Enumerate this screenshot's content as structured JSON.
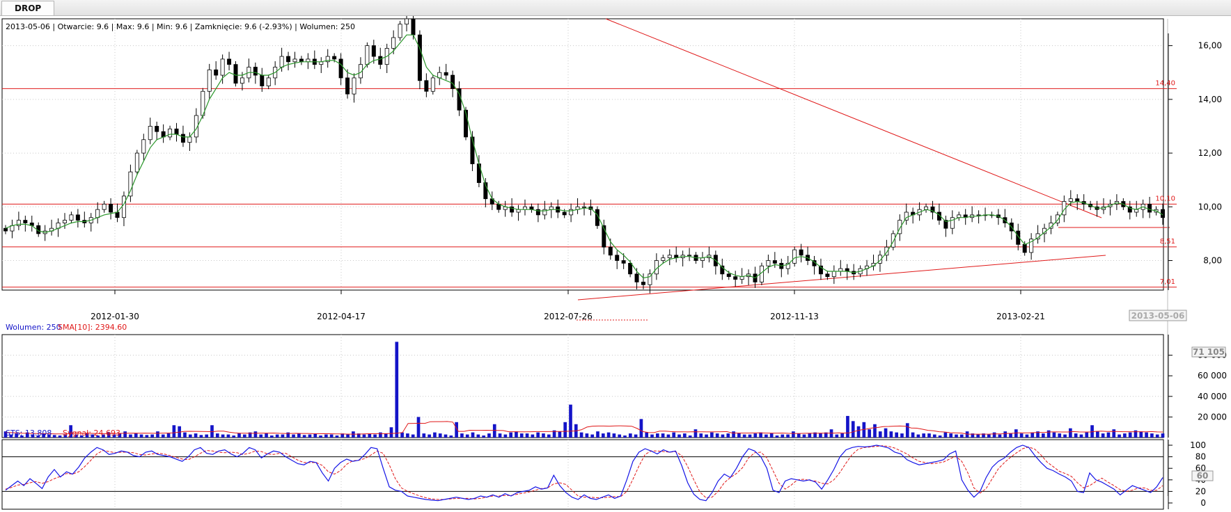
{
  "window": {
    "tab_label": "DROP"
  },
  "chart_data": [
    {
      "type": "candlestick",
      "title": "",
      "info": "2013-05-06 | Otwarcie: 9.6 | Max: 9.6 | Min: 9.6 | Zamknięcie: 9.6 (-2.93%)  | Wolumen: 250",
      "x_axis": {
        "ticks": [
          "2012-01-30",
          "2012-04-17",
          "2012-07-26",
          "2012-11-13",
          "2013-02-21"
        ],
        "current_label": "2013-05-06"
      },
      "y_axis": {
        "range": [
          6.9,
          17.0
        ],
        "ticks": [
          8,
          10,
          12,
          14,
          16
        ],
        "tick_labels": [
          "8,00",
          "10,00",
          "12,00",
          "14,00",
          "16,00"
        ],
        "side": "right"
      },
      "grid": true,
      "horizontal_lines": [
        {
          "value": 14.4,
          "label": "14,40"
        },
        {
          "value": 10.1,
          "label": "10,10"
        },
        {
          "value": 8.51,
          "label": "8,51"
        },
        {
          "value": 7.01,
          "label": "7,01"
        }
      ],
      "overlay_color": "#2a962a",
      "line_color": "#e01818",
      "candle_up_color": "#ffffff",
      "candle_down_color": "#000000",
      "closes": [
        9.1,
        9.3,
        9.5,
        9.4,
        9.3,
        9.0,
        9.1,
        9.2,
        9.4,
        9.5,
        9.7,
        9.5,
        9.4,
        9.6,
        9.9,
        10.1,
        9.8,
        9.6,
        10.4,
        11.3,
        12.0,
        12.5,
        13.0,
        12.8,
        12.6,
        12.9,
        12.7,
        12.4,
        12.6,
        13.4,
        14.3,
        15.1,
        14.9,
        15.5,
        15.3,
        14.6,
        14.8,
        15.2,
        14.9,
        14.5,
        14.8,
        15.2,
        15.6,
        15.4,
        15.5,
        15.4,
        15.5,
        15.3,
        15.4,
        15.6,
        15.5,
        14.8,
        14.2,
        14.8,
        15.3,
        16.0,
        15.6,
        15.3,
        15.9,
        16.3,
        16.8,
        17.0,
        16.4,
        14.7,
        14.3,
        14.8,
        15.0,
        14.9,
        14.4,
        13.6,
        12.6,
        11.6,
        10.9,
        10.3,
        10.1,
        9.9,
        10.0,
        9.8,
        9.9,
        10.0,
        9.9,
        9.7,
        9.9,
        10.0,
        9.8,
        9.7,
        9.9,
        10.0,
        10.0,
        9.9,
        9.3,
        8.5,
        8.2,
        8.0,
        7.9,
        7.5,
        7.2,
        7.1,
        7.5,
        8.0,
        8.1,
        8.2,
        8.1,
        8.2,
        8.2,
        8.0,
        8.1,
        8.2,
        7.8,
        7.5,
        7.4,
        7.3,
        7.4,
        7.5,
        7.2,
        7.8,
        8.0,
        7.9,
        7.7,
        7.9,
        8.4,
        8.2,
        8.0,
        7.8,
        7.5,
        7.4,
        7.6,
        7.7,
        7.6,
        7.5,
        7.7,
        7.8,
        7.9,
        8.2,
        8.5,
        9.0,
        9.5,
        9.8,
        9.7,
        9.9,
        10.0,
        9.8,
        9.5,
        9.2,
        9.6,
        9.7,
        9.6,
        9.7,
        9.7,
        9.7,
        9.7,
        9.6,
        9.4,
        9.1,
        8.6,
        8.3,
        8.8,
        9.0,
        9.2,
        9.4,
        9.7,
        10.2,
        10.3,
        10.2,
        10.1,
        10.0,
        9.9,
        10.0,
        10.1,
        10.2,
        10.0,
        9.8,
        9.9,
        10.1,
        9.8,
        9.9,
        9.6
      ],
      "sma_overlay": [
        9.2,
        9.3,
        9.35,
        9.35,
        9.3,
        9.1,
        9.05,
        9.1,
        9.2,
        9.3,
        9.4,
        9.45,
        9.45,
        9.5,
        9.6,
        9.7,
        9.75,
        9.8,
        10.1,
        10.6,
        11.2,
        11.7,
        12.2,
        12.5,
        12.6,
        12.7,
        12.7,
        12.6,
        12.6,
        12.9,
        13.4,
        14.0,
        14.4,
        14.8,
        15.0,
        14.9,
        14.9,
        15.0,
        15.0,
        14.9,
        14.9,
        15.0,
        15.2,
        15.3,
        15.35,
        15.4,
        15.4,
        15.4,
        15.4,
        15.45,
        15.45,
        15.3,
        15.0,
        14.9,
        15.0,
        15.3,
        15.45,
        15.5,
        15.6,
        15.8,
        16.1,
        16.4,
        16.4,
        15.9,
        15.2,
        14.9,
        14.8,
        14.7,
        14.6,
        14.2,
        13.5,
        12.5,
        11.6,
        10.8,
        10.3,
        10.1,
        10.0,
        9.95,
        9.9,
        9.9,
        9.9,
        9.85,
        9.85,
        9.9,
        9.9,
        9.85,
        9.85,
        9.9,
        9.95,
        9.95,
        9.7,
        9.2,
        8.7,
        8.4,
        8.2,
        7.95,
        7.6,
        7.35,
        7.4,
        7.7,
        7.9,
        8.05,
        8.1,
        8.15,
        8.15,
        8.1,
        8.1,
        8.15,
        8.0,
        7.75,
        7.55,
        7.45,
        7.4,
        7.45,
        7.35,
        7.55,
        7.75,
        7.85,
        7.8,
        7.85,
        8.1,
        8.15,
        8.1,
        7.95,
        7.75,
        7.6,
        7.6,
        7.6,
        7.6,
        7.55,
        7.6,
        7.7,
        7.8,
        8.0,
        8.3,
        8.7,
        9.2,
        9.6,
        9.7,
        9.8,
        9.9,
        9.85,
        9.7,
        9.45,
        9.5,
        9.6,
        9.6,
        9.65,
        9.65,
        9.7,
        9.7,
        9.65,
        9.5,
        9.25,
        8.9,
        8.6,
        8.7,
        8.85,
        9.05,
        9.25,
        9.5,
        9.9,
        10.15,
        10.2,
        10.15,
        10.05,
        9.95,
        9.95,
        10.05,
        10.15,
        10.1,
        9.95,
        9.9,
        10.0,
        9.9,
        9.85,
        9.7
      ],
      "annotations": [
        {
          "value": 17.2,
          "index": 48
        },
        {
          "value": 7.0,
          "index": 100
        }
      ]
    },
    {
      "type": "bar",
      "info_parts": [
        "Wolumen: 250",
        "SMA[10]: 2394.60"
      ],
      "y_axis": {
        "range": [
          0,
          100000
        ],
        "ticks": [
          20000,
          40000,
          60000,
          80000
        ],
        "tick_labels": [
          "20 000",
          "40 000",
          "60 000",
          "80 000"
        ],
        "current_value_label": "71 105"
      },
      "bar_color": "#1414c8",
      "sma_color": "#e01818",
      "values": [
        6000,
        3000,
        4000,
        2000,
        5000,
        3000,
        2000,
        4000,
        3000,
        2500,
        2000,
        3000,
        12000,
        3000,
        2000,
        4000,
        3000,
        2000,
        3000,
        5000,
        3000,
        4000,
        6000,
        3000,
        4000,
        3000,
        2500,
        3000,
        6000,
        3000,
        4000,
        12000,
        11000,
        5000,
        3000,
        4000,
        2500,
        3000,
        12000,
        4000,
        3000,
        3000,
        2000,
        4000,
        3000,
        5000,
        6000,
        3000,
        4000,
        2000,
        3000,
        3000,
        5000,
        3000,
        4000,
        2500,
        3000,
        4000,
        2000,
        3000,
        3000,
        2000,
        4000,
        3000,
        6000,
        4000,
        3000,
        4000,
        3000,
        5000,
        4000,
        10000,
        93000,
        5000,
        4000,
        3000,
        20000,
        4000,
        3000,
        5000,
        4000,
        3000,
        2000,
        15000,
        4000,
        3000,
        5000,
        3000,
        2000,
        4000,
        13000,
        4000,
        3000,
        5000,
        6000,
        4000,
        4000,
        3000,
        5000,
        4000,
        3000,
        7000,
        6000,
        15000,
        32000,
        13000,
        5000,
        4000,
        3000,
        6000,
        4000,
        5000,
        4000,
        3000,
        2000,
        4000,
        3000,
        18000,
        5000,
        3000,
        4000,
        4000,
        3000,
        5000,
        3000,
        4000,
        2000,
        8000,
        4000,
        3000,
        5000,
        4000,
        3000,
        4000,
        6000,
        4000,
        3000,
        3000,
        4000,
        5000,
        3000,
        4000,
        2000,
        3000,
        3000,
        6000,
        4000,
        3000,
        4000,
        5000,
        4000,
        5000,
        8000,
        3000,
        4000,
        21000,
        16000,
        11000,
        15000,
        8000,
        13000,
        6000,
        9000,
        6000,
        5000,
        4000,
        14000,
        5000,
        3000,
        4000,
        4000,
        3000,
        2000,
        5000,
        4000,
        3000,
        3000,
        6000,
        4000,
        3000,
        4000,
        3000,
        5000,
        3000,
        6000,
        4000,
        8000,
        4000,
        3000,
        5000,
        6000,
        4000,
        7000,
        5000,
        4000,
        3000,
        9000,
        4000,
        3000,
        5000,
        12000,
        6000,
        4000,
        5000,
        8000,
        3000,
        4000,
        5000,
        7000,
        6000,
        5000,
        4000,
        3000,
        4000
      ],
      "sma": [
        5000,
        4800,
        4600,
        4200,
        4100,
        4000,
        3900,
        3800,
        3700,
        3600,
        3500,
        3600,
        4400,
        4300,
        4200,
        4100,
        4000,
        3900,
        3800,
        3900,
        4000,
        4100,
        4200,
        4300,
        4200,
        4300,
        4200,
        4100,
        4300,
        4400,
        4500,
        5200,
        6000,
        6100,
        6000,
        5900,
        5800,
        5700,
        6200,
        6200,
        5300,
        4500,
        4200,
        4200,
        4100,
        4200,
        4300,
        4300,
        4400,
        4100,
        4000,
        4000,
        4100,
        4000,
        4000,
        3800,
        3700,
        3800,
        3700,
        3600,
        3500,
        3400,
        3300,
        3300,
        3600,
        3700,
        3700,
        3800,
        3800,
        4000,
        4200,
        4900,
        13700,
        13800,
        13900,
        13800,
        15400,
        15500,
        15500,
        15600,
        15000,
        6000,
        6000,
        7100,
        7000,
        7000,
        7100,
        7000,
        6900,
        6800,
        5700,
        5700,
        5600,
        5600,
        5700,
        5800,
        5800,
        5800,
        5900,
        5900,
        6000,
        6200,
        6400,
        7600,
        10200,
        11100,
        11200,
        11200,
        11100,
        11300,
        11400,
        11200,
        11000,
        8800,
        5800,
        4900,
        4800,
        6200,
        6200,
        5800,
        5600,
        5600,
        5500,
        5700,
        5600,
        5600,
        5500,
        5600,
        5700,
        5800,
        4400,
        4400,
        4400,
        4400,
        4500,
        4500,
        4400,
        4300,
        4300,
        4400,
        4100,
        4000,
        4000,
        4100,
        4200,
        4200,
        4300,
        4300,
        4300,
        4500,
        4400,
        4500,
        6200,
        7400,
        8300,
        9300,
        9800,
        10700,
        10800,
        11100,
        11200,
        11000,
        9300,
        9100,
        8100,
        7000,
        6600,
        5700,
        5400,
        4700,
        4600,
        4400,
        3300,
        3300,
        3300,
        3300,
        3400,
        3600,
        3600,
        4000,
        4100,
        4600,
        4600,
        4600,
        4800,
        5000,
        5100,
        5500,
        5500,
        5400,
        5400,
        5800,
        5500,
        5400,
        5400,
        6000,
        6200,
        5900,
        6000,
        5800,
        5700,
        5700,
        5700,
        5700,
        5600,
        5800,
        5500,
        5400
      ]
    },
    {
      "type": "line",
      "info_parts": [
        "STS: 13.808",
        "Sygnał: 24.693"
      ],
      "y_axis": {
        "range": [
          0,
          100
        ],
        "ticks": [
          0,
          20,
          40,
          60,
          80,
          100
        ],
        "tick_labels": [
          "0",
          "20",
          "40",
          "60",
          "80",
          "100"
        ],
        "current_value_label": "60",
        "levels": [
          20,
          80
        ]
      },
      "series": [
        {
          "name": "STS",
          "color": "#1414e6",
          "values": [
            22,
            30,
            38,
            30,
            42,
            34,
            25,
            45,
            58,
            45,
            54,
            50,
            62,
            78,
            88,
            96,
            92,
            84,
            86,
            90,
            88,
            82,
            80,
            88,
            90,
            84,
            82,
            80,
            76,
            72,
            80,
            92,
            96,
            86,
            84,
            90,
            92,
            85,
            80,
            86,
            96,
            92,
            78,
            85,
            90,
            88,
            80,
            74,
            68,
            66,
            72,
            70,
            52,
            38,
            60,
            70,
            76,
            72,
            74,
            84,
            96,
            94,
            60,
            28,
            22,
            20,
            12,
            10,
            8,
            6,
            5,
            4,
            6,
            8,
            10,
            8,
            6,
            8,
            12,
            10,
            14,
            10,
            16,
            12,
            18,
            20,
            22,
            28,
            24,
            26,
            48,
            30,
            18,
            10,
            6,
            14,
            8,
            6,
            10,
            14,
            8,
            12,
            40,
            72,
            88,
            94,
            90,
            85,
            92,
            88,
            90,
            65,
            35,
            15,
            6,
            4,
            18,
            38,
            50,
            44,
            60,
            80,
            94,
            90,
            80,
            60,
            22,
            18,
            38,
            42,
            40,
            38,
            40,
            36,
            24,
            40,
            58,
            80,
            92,
            96,
            98,
            97,
            98,
            100,
            98,
            95,
            88,
            85,
            75,
            70,
            66,
            68,
            70,
            72,
            75,
            85,
            90,
            40,
            22,
            10,
            20,
            44,
            62,
            72,
            78,
            88,
            96,
            100,
            96,
            82,
            70,
            60,
            56,
            50,
            45,
            38,
            20,
            18,
            52,
            40,
            36,
            30,
            24,
            14,
            22,
            30,
            26,
            22,
            18,
            28,
            44
          ]
        },
        {
          "name": "Sygnał",
          "color": "#e01818",
          "values": [
            24,
            27,
            31,
            32,
            35,
            37,
            34,
            37,
            42,
            46,
            51,
            50,
            54,
            63,
            74,
            85,
            91,
            89,
            87,
            88,
            88,
            87,
            84,
            83,
            85,
            86,
            85,
            82,
            79,
            76,
            75,
            80,
            86,
            91,
            90,
            88,
            87,
            88,
            87,
            84,
            86,
            90,
            89,
            85,
            84,
            86,
            86,
            80,
            74,
            70,
            70,
            70,
            65,
            54,
            50,
            56,
            67,
            73,
            74,
            77,
            83,
            90,
            86,
            66,
            42,
            26,
            20,
            16,
            12,
            9,
            7,
            6,
            6,
            7,
            8,
            8,
            8,
            7,
            8,
            10,
            12,
            12,
            13,
            13,
            15,
            17,
            19,
            22,
            25,
            26,
            33,
            35,
            32,
            22,
            12,
            10,
            10,
            9,
            9,
            10,
            11,
            11,
            20,
            41,
            64,
            84,
            90,
            90,
            89,
            88,
            89,
            82,
            63,
            40,
            19,
            9,
            10,
            20,
            35,
            44,
            51,
            61,
            78,
            87,
            88,
            78,
            56,
            34,
            24,
            31,
            40,
            41,
            39,
            38,
            34,
            33,
            40,
            53,
            69,
            84,
            93,
            96,
            97,
            98,
            99,
            98,
            95,
            90,
            85,
            78,
            72,
            70,
            68,
            69,
            71,
            76,
            81,
            72,
            52,
            26,
            17,
            25,
            42,
            59,
            70,
            79,
            87,
            94,
            97,
            93,
            83,
            71,
            63,
            55,
            51,
            46,
            35,
            26,
            30,
            37,
            43,
            36,
            30,
            23,
            20,
            22,
            26,
            26,
            22,
            22,
            30
          ]
        }
      ]
    }
  ]
}
